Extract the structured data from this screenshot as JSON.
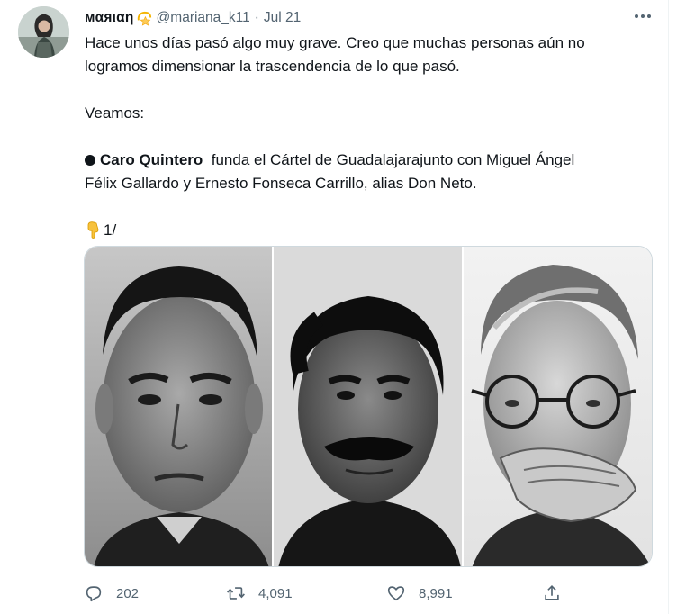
{
  "tweet": {
    "display_name": "мαяιαη",
    "handle": "@mariana_k11",
    "separator": "·",
    "date": "Jul 21",
    "lines": {
      "line1": "Hace unos días pasó algo muy grave. Creo que muchas personas aún no",
      "line2": "logramos dimensionar la trascendencia de lo que pasó.",
      "line3": "Veamos:",
      "line4_bold": "Caro Quintero",
      "line4_rest": "  funda el Cártel de Guadalajarajunto con Miguel Ángel",
      "line5": "Félix Gallardo y Ernesto Fonseca Carrillo, alias Don Neto.",
      "line6": "1/"
    },
    "icons": {
      "name_emoji": "dizzy-star-emoji",
      "bullet": "black-circle",
      "thread_emoji": "backhand-index-pointing-down-emoji",
      "more": "more-horizontal-icon"
    },
    "media": {
      "kind": "three black-and-white portrait photos"
    },
    "actions": {
      "replies": "202",
      "retweets": "4,091",
      "likes": "8,991"
    },
    "colors": {
      "text": "#0f1419",
      "secondary": "#536471",
      "border": "#cfd9de"
    }
  }
}
